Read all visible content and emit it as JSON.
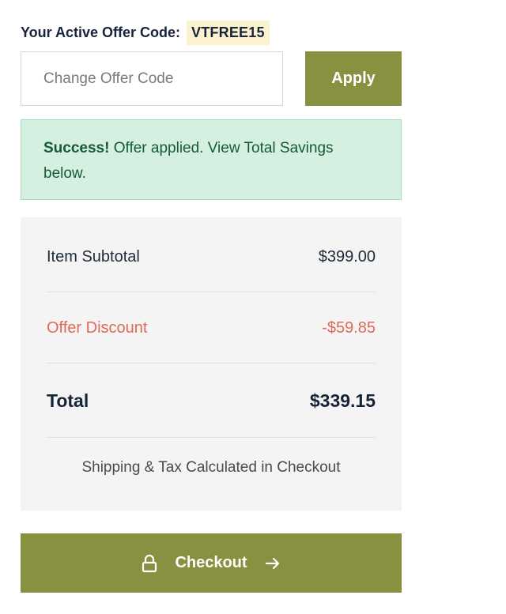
{
  "offer": {
    "label": "Your Active Offer Code:",
    "code": "VTFREE15",
    "input_placeholder": "Change Offer Code",
    "input_value": "",
    "apply_label": "Apply"
  },
  "alert": {
    "strong": "Success!",
    "message": " Offer applied. View Total Savings below."
  },
  "summary": {
    "subtotal_label": "Item Subtotal",
    "subtotal_value": "$399.00",
    "discount_label": "Offer Discount",
    "discount_value": "-$59.85",
    "total_label": "Total",
    "total_value": "$339.15",
    "shipping_note": "Shipping & Tax Calculated in Checkout"
  },
  "checkout": {
    "label": "Checkout",
    "left_icon": "lock-icon",
    "right_icon": "arrow-right-icon"
  },
  "colors": {
    "accent": "#87913f",
    "success_bg": "#d5efe1",
    "discount_text": "#e06a57",
    "code_highlight": "#fdf2cf",
    "summary_bg": "#f4f4f4"
  }
}
